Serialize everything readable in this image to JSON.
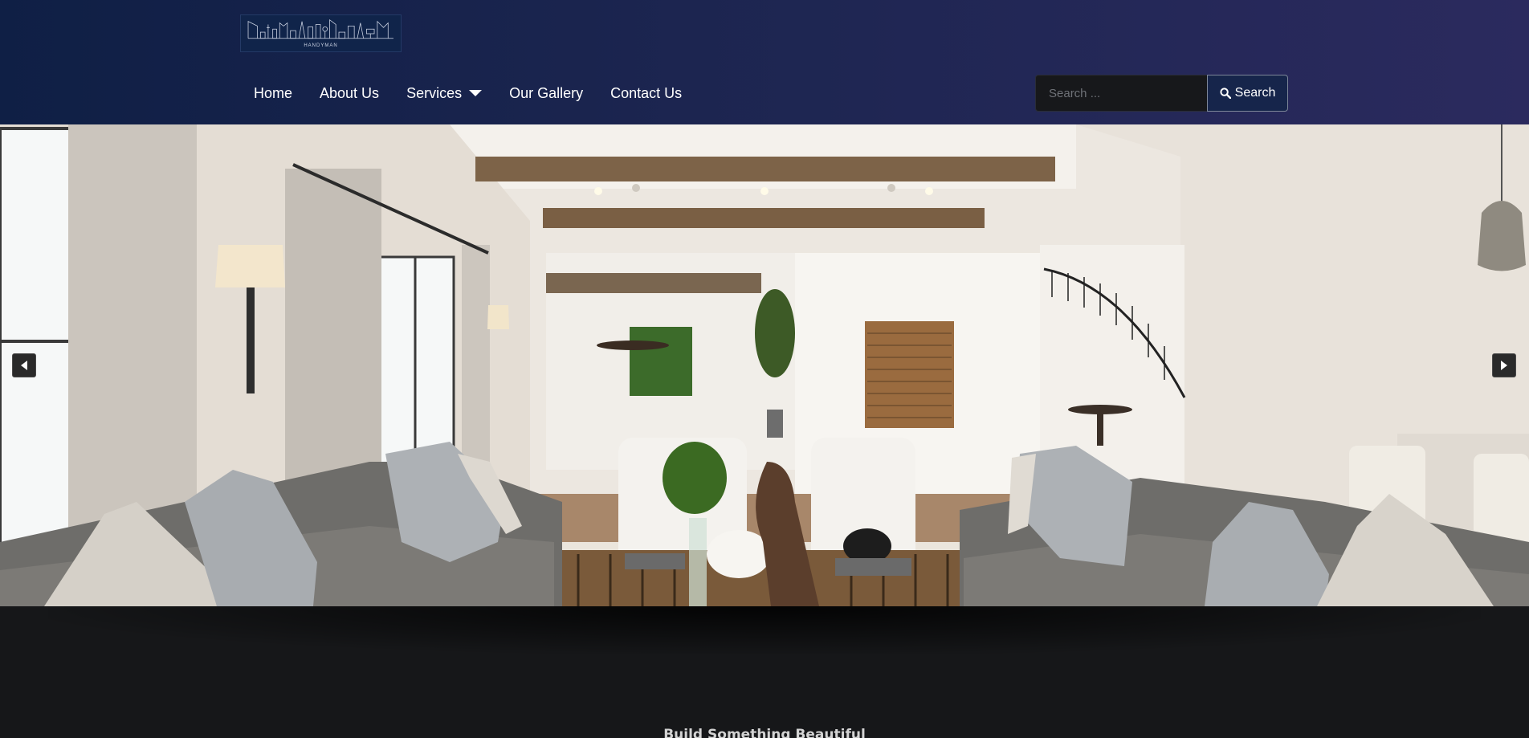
{
  "header": {
    "logo": {
      "icon": "handyman-tools-logo",
      "text": "HANDYMAN"
    },
    "nav": [
      {
        "label": "Home"
      },
      {
        "label": "About Us"
      },
      {
        "label": "Services",
        "has_dropdown": true
      },
      {
        "label": "Our Gallery"
      },
      {
        "label": "Contact Us"
      }
    ],
    "search": {
      "placeholder": "Search ...",
      "button_label": "Search",
      "icon": "search-icon"
    }
  },
  "hero": {
    "image": "living-room-interior-photo",
    "controls": {
      "prev_icon": "arrow-left-icon",
      "next_icon": "arrow-right-icon"
    }
  },
  "content": {
    "tagline": "Build Something Beautiful"
  },
  "colors": {
    "header_start": "#0f1f45",
    "header_end": "#2b2a5e",
    "page_background": "#161719",
    "search_button": "#16254b"
  }
}
